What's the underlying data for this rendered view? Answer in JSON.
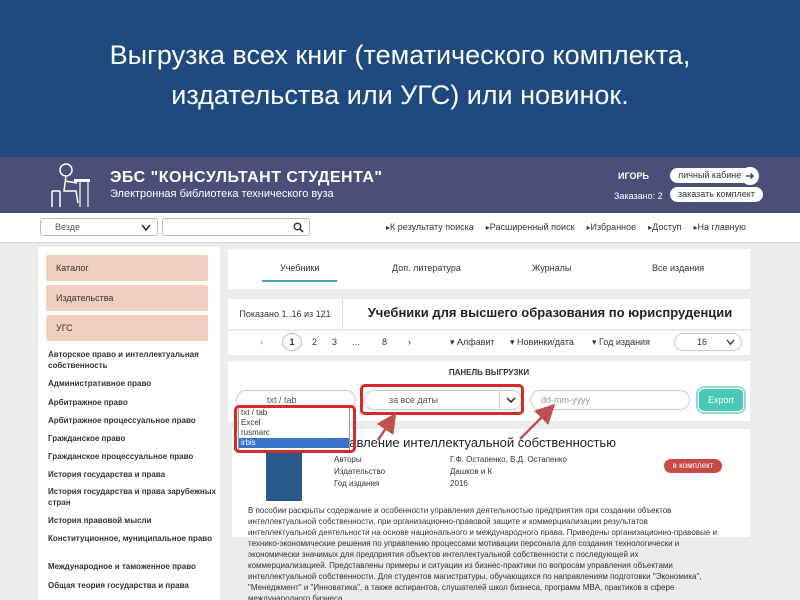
{
  "slide": {
    "title_line1": "Выгрузка всех книг (тематического комплекта,",
    "title_line2": "издательства или УГС) или новинок."
  },
  "header": {
    "brand_title": "ЭБС \"КОНСУЛЬТАНТ СТУДЕНТА\"",
    "brand_subtitle": "Электронная библиотека технического вуза",
    "user_name": "ИГОРЬ",
    "cabinet_button": "личный кабинет",
    "ordered_label": "Заказано:",
    "ordered_count": "2",
    "order_button": "заказать комплект"
  },
  "toolbar": {
    "scope": "Везде",
    "nav": [
      "К результату поиска",
      "Расширенный поиск",
      "Избранное",
      "Доступ",
      "На главную"
    ]
  },
  "sidebar": {
    "categories": [
      "Каталог",
      "Издательства",
      "УГС"
    ],
    "items": [
      "Авторское право и интеллектуальная собственность",
      "Административное право",
      "Арбитражное право",
      "Арбитражное процессуальное право",
      "Гражданское право",
      "Гражданское процессуальное право",
      "История государства и права",
      "История государства и права зарубежных стран",
      "История правовой мысли",
      "Конституционное, муниципальное право",
      "Международное и таможенное право",
      "Общая теория государства и права"
    ]
  },
  "tabs": [
    "Учебники",
    "Доп. литература",
    "Журналы",
    "Все издания"
  ],
  "results": {
    "count": "Показано 1..16 из 121",
    "title": "Учебники для высшего образования по юриспруденции"
  },
  "pager": {
    "prev": "‹",
    "pages": [
      "1",
      "2",
      "3",
      "...",
      "8"
    ],
    "next": "›",
    "sort_alpha": "Алфавит",
    "sort_new": "Новинки/дата",
    "sort_year": "Год издания",
    "per_page": "16"
  },
  "export_panel": {
    "title": "ПАНЕЛЬ ВЫГРУЗКИ",
    "format": "txt / tab",
    "format_options": [
      "txt / tab",
      "Excel",
      "rusmarc",
      "irbis"
    ],
    "date_range": "за все даты",
    "date_placeholder": "dd-mm-yyyy",
    "export_button": "Export"
  },
  "book": {
    "title": "равление интеллектуальной собственностью",
    "labels": [
      "Авторы",
      "Издательство",
      "Год издания"
    ],
    "values": [
      "Г.Ф. Остапенко, В.Д. Остапенко",
      "Дашков и К",
      "2016"
    ],
    "to_set_button": "в комплект",
    "annotation": "В пособии раскрыты содержание и особенности управления деятельностью предприятия при создании объектов интеллектуальной собственности, при организационно-правовой защите и коммерциализации результатов интеллектуальной деятельности на основе национального и международного права. Приведены организационно-правовые и технико-экономические решения по управлению процессами мотивации персонала для создания технологически и экономически значимых для предприятия объектов интеллектуальной собственности с последующей их коммерциализацией. Представлены примеры и ситуации из бизнес-практики по вопросам управления объектами интеллектуальной собственности. Для студентов магистратуры, обучающихся по направлениям подготовки \"Экономика\", \"Менеджмент\" и \"Инноватика\", а также аспирантов, слушателей школ бизнеса, программ MBA, практиков в сфере международного бизнеса."
  },
  "colors": {
    "slide_bg": "#1f4a80",
    "header_bg": "#4b4e79",
    "accent": "#3aa8b5",
    "export_button": "#49c8b7",
    "highlight": "#d62a2a",
    "category_bg": "#f1cfbf"
  }
}
